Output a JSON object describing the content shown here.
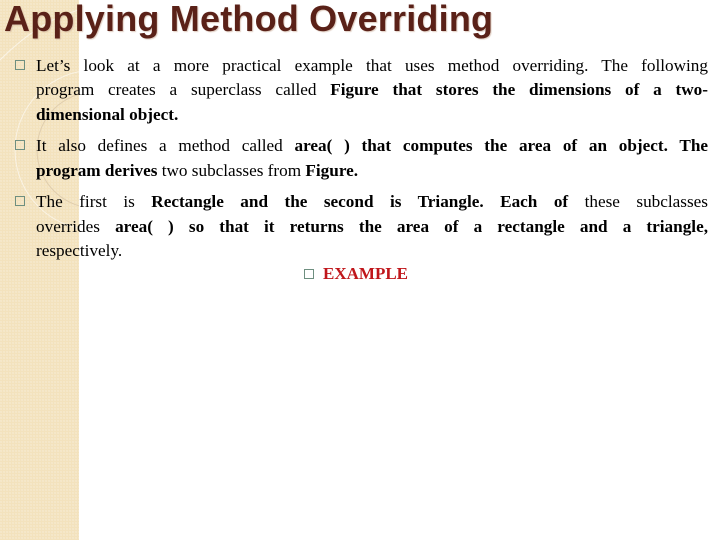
{
  "slide": {
    "title": "Applying Method Overriding",
    "bullets": [
      {
        "lines": [
          [
            {
              "t": "Let’s look at a more practical example that uses method overriding. The following",
              "b": false
            }
          ],
          [
            {
              "t": "program creates a superclass called ",
              "b": false
            },
            {
              "t": "Figure that stores the dimensions of a two-",
              "b": true
            }
          ],
          [
            {
              "t": "dimensional object.",
              "b": true
            }
          ]
        ]
      },
      {
        "lines": [
          [
            {
              "t": "It also defines a method called ",
              "b": false
            },
            {
              "t": "area( ) that computes the area of an object. The",
              "b": true
            }
          ],
          [
            {
              "t": "program derives",
              "b": true
            },
            {
              "t": " two subclasses from ",
              "b": false
            },
            {
              "t": "Figure.",
              "b": true
            }
          ]
        ]
      },
      {
        "lines": [
          [
            {
              "t": "The first is ",
              "b": false
            },
            {
              "t": "Rectangle and the second is Triangle. Each of",
              "b": true
            },
            {
              "t": " these subclasses",
              "b": false
            }
          ],
          [
            {
              "t": "overrides ",
              "b": false
            },
            {
              "t": "area( ) so that it returns the area of a rectangle and a triangle,",
              "b": true
            }
          ],
          [
            {
              "t": "respectively.",
              "b": false
            }
          ]
        ]
      }
    ],
    "example_link": "EXAMPLE"
  },
  "colors": {
    "title": "#5a2118",
    "example": "#c0161b",
    "panel": "#f3e2bd",
    "bullet_box": "#6e8f80"
  }
}
